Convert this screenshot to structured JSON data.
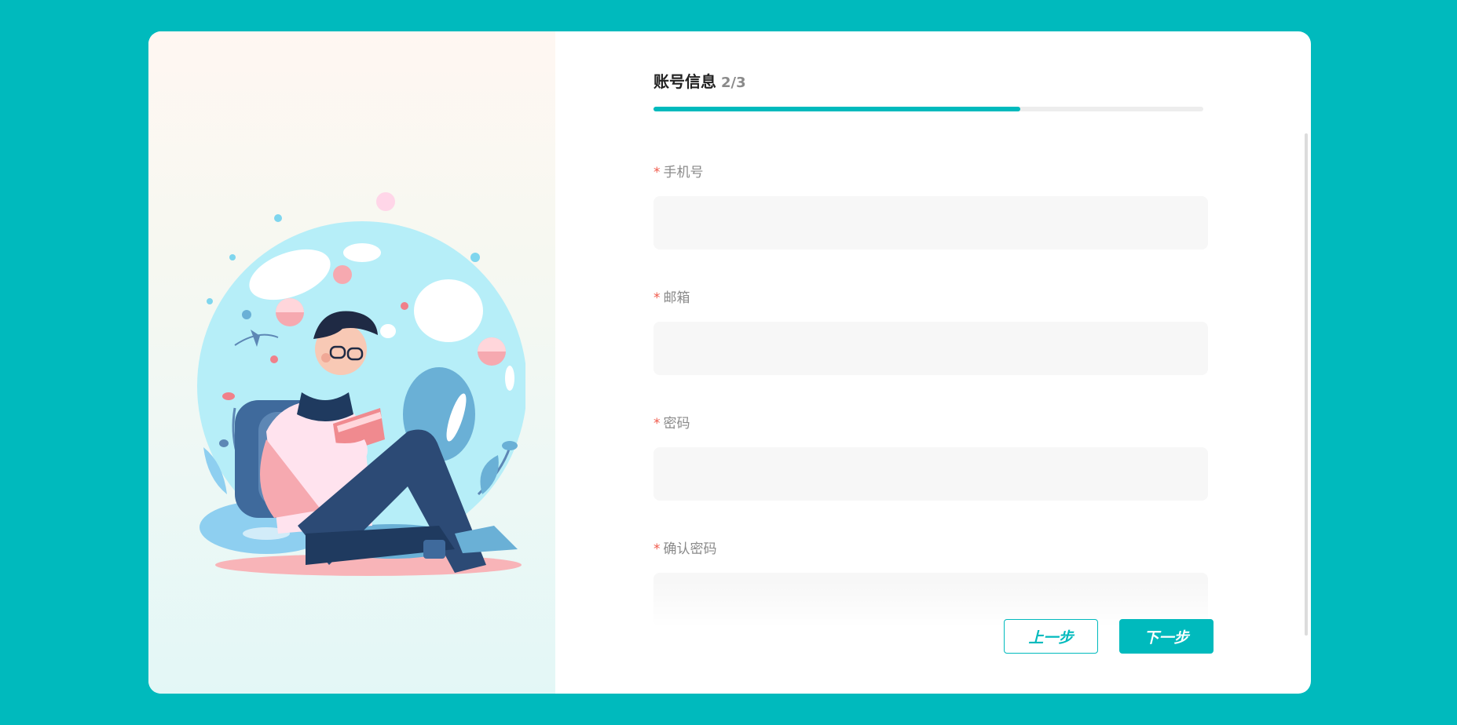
{
  "form": {
    "step_title": "账号信息",
    "step_count": "2/3",
    "progress_fraction": 0.667,
    "required_mark": "*",
    "fields": [
      {
        "label": "手机号",
        "value": ""
      },
      {
        "label": "邮箱",
        "value": ""
      },
      {
        "label": "密码",
        "value": ""
      },
      {
        "label": "确认密码",
        "value": ""
      }
    ]
  },
  "actions": {
    "prev_label": "上一步",
    "next_label": "下一步"
  },
  "colors": {
    "accent": "#00babd",
    "required": "#f05a4b",
    "input_bg": "#f7f7f7",
    "label": "#8a8a8a"
  },
  "illustration": {
    "subject": "person-reading-book-in-bubble"
  }
}
